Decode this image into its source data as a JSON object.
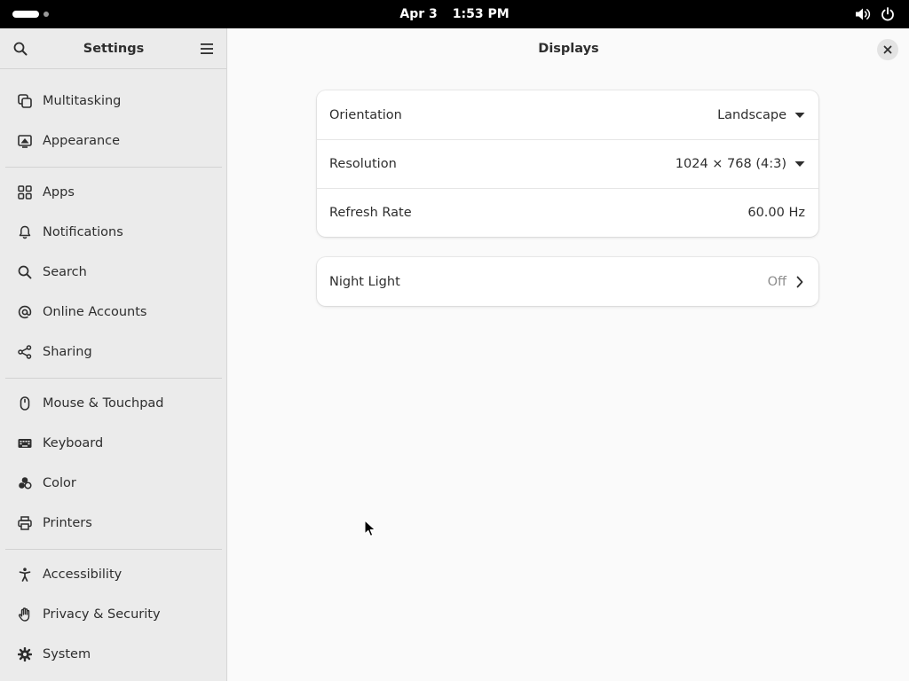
{
  "topbar": {
    "date": "Apr 3",
    "time": "1:53 PM",
    "icons": [
      "volume-icon",
      "power-icon"
    ]
  },
  "sidebar": {
    "title": "Settings",
    "search_icon": "search-icon",
    "menu_icon": "hamburger-menu-icon",
    "items": [
      {
        "label": "Multitasking",
        "icon": "multitasking-icon"
      },
      {
        "label": "Appearance",
        "icon": "appearance-icon"
      },
      {
        "label": "Apps",
        "icon": "apps-grid-icon"
      },
      {
        "label": "Notifications",
        "icon": "bell-icon"
      },
      {
        "label": "Search",
        "icon": "search-icon"
      },
      {
        "label": "Online Accounts",
        "icon": "at-icon"
      },
      {
        "label": "Sharing",
        "icon": "share-icon"
      },
      {
        "label": "Mouse & Touchpad",
        "icon": "mouse-icon"
      },
      {
        "label": "Keyboard",
        "icon": "keyboard-icon"
      },
      {
        "label": "Color",
        "icon": "color-icon"
      },
      {
        "label": "Printers",
        "icon": "printer-icon"
      },
      {
        "label": "Accessibility",
        "icon": "accessibility-icon"
      },
      {
        "label": "Privacy & Security",
        "icon": "hand-icon"
      },
      {
        "label": "System",
        "icon": "gear-icon"
      }
    ]
  },
  "main": {
    "title": "Displays",
    "close_icon": "close-icon",
    "display_settings": [
      {
        "label": "Orientation",
        "value": "Landscape",
        "control": "dropdown"
      },
      {
        "label": "Resolution",
        "value": "1024 × 768 (4:3)",
        "control": "dropdown"
      },
      {
        "label": "Refresh Rate",
        "value": "60.00 Hz",
        "control": "none"
      }
    ],
    "night_light": {
      "label": "Night Light",
      "value": "Off",
      "control": "chevron-right"
    }
  },
  "colors": {
    "topbar_bg": "#000000",
    "sidebar_bg": "#ebebeb",
    "main_bg": "#fafafa",
    "card_bg": "#ffffff",
    "text": "#2e2e2e",
    "muted_text": "#8d8d8d"
  }
}
